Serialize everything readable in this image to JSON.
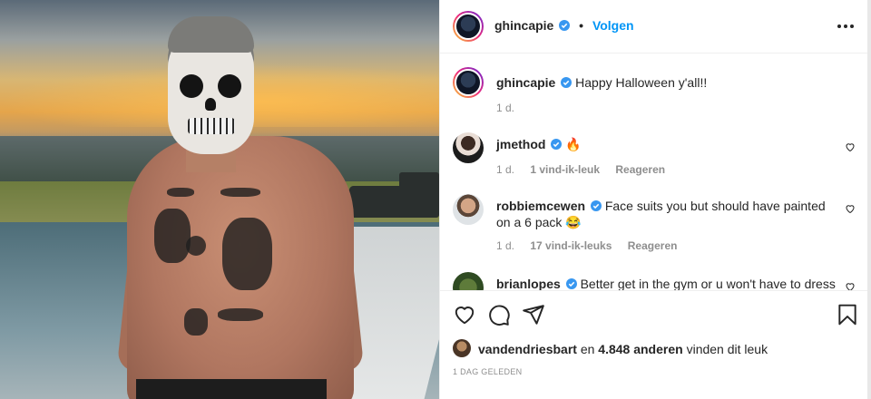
{
  "post": {
    "author": "ghincapie",
    "verified": true,
    "separator": "•",
    "follow_label": "Volgen",
    "more_icon": "more-options-icon"
  },
  "caption": {
    "username": "ghincapie",
    "text": "Happy Halloween y'all!!",
    "time": "1 d."
  },
  "comments": [
    {
      "username": "jmethod",
      "text": "🔥",
      "time": "1 d.",
      "likes": "1 vind-ik-leuk",
      "reply": "Reageren"
    },
    {
      "username": "robbiemcewen",
      "text": "Face suits you but should have painted on a 6 pack 😂",
      "time": "1 d.",
      "likes": "17 vind-ik-leuks",
      "reply": "Reageren"
    },
    {
      "username": "brianlopes",
      "text": "Better get in the gym or u won't have to dress"
    }
  ],
  "likes": {
    "first_user": "vandendriesbart",
    "connector": "en",
    "others": "4.848 anderen",
    "suffix": "vinden dit leuk"
  },
  "timestamp": "1 DAG GELEDEN",
  "colors": {
    "accent": "#0095f6",
    "verified": "#3897f0",
    "muted": "#8e8e8e",
    "text": "#262626"
  }
}
